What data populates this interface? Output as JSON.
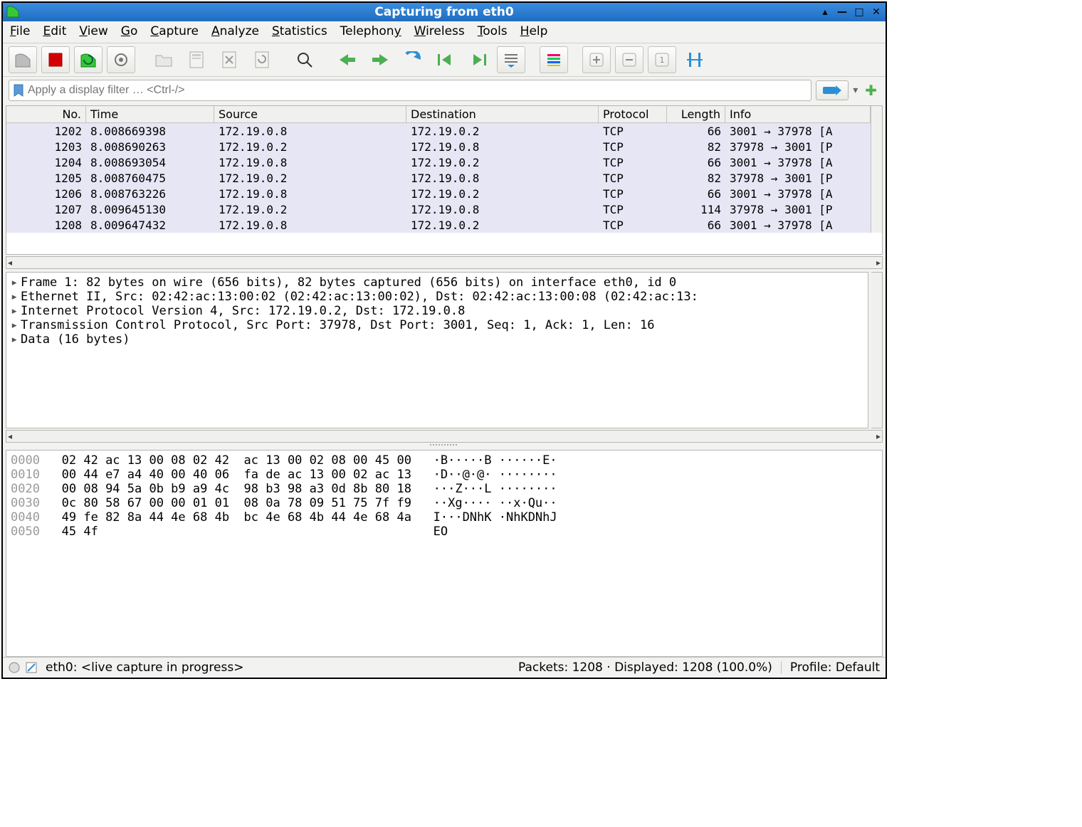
{
  "window": {
    "title": "Capturing from eth0"
  },
  "menu": {
    "items": [
      {
        "label": "File",
        "ukey": "F"
      },
      {
        "label": "Edit",
        "ukey": "E"
      },
      {
        "label": "View",
        "ukey": "V"
      },
      {
        "label": "Go",
        "ukey": "G"
      },
      {
        "label": "Capture",
        "ukey": "C"
      },
      {
        "label": "Analyze",
        "ukey": "A"
      },
      {
        "label": "Statistics",
        "ukey": "S"
      },
      {
        "label": "Telephony",
        "ukey": "y"
      },
      {
        "label": "Wireless",
        "ukey": "W"
      },
      {
        "label": "Tools",
        "ukey": "T"
      },
      {
        "label": "Help",
        "ukey": "H"
      }
    ]
  },
  "filter": {
    "placeholder": "Apply a display filter … <Ctrl-/>"
  },
  "columns": {
    "no": "No.",
    "time": "Time",
    "src": "Source",
    "dst": "Destination",
    "proto": "Protocol",
    "len": "Length",
    "info": "Info"
  },
  "packets": [
    {
      "no": "1202",
      "time": "8.008669398",
      "src": "172.19.0.8",
      "dst": "172.19.0.2",
      "proto": "TCP",
      "len": "66",
      "info": "3001 → 37978  [A"
    },
    {
      "no": "1203",
      "time": "8.008690263",
      "src": "172.19.0.2",
      "dst": "172.19.0.8",
      "proto": "TCP",
      "len": "82",
      "info": "37978 → 3001  [P"
    },
    {
      "no": "1204",
      "time": "8.008693054",
      "src": "172.19.0.8",
      "dst": "172.19.0.2",
      "proto": "TCP",
      "len": "66",
      "info": "3001 → 37978  [A"
    },
    {
      "no": "1205",
      "time": "8.008760475",
      "src": "172.19.0.2",
      "dst": "172.19.0.8",
      "proto": "TCP",
      "len": "82",
      "info": "37978 → 3001  [P"
    },
    {
      "no": "1206",
      "time": "8.008763226",
      "src": "172.19.0.8",
      "dst": "172.19.0.2",
      "proto": "TCP",
      "len": "66",
      "info": "3001 → 37978  [A"
    },
    {
      "no": "1207",
      "time": "8.009645130",
      "src": "172.19.0.2",
      "dst": "172.19.0.8",
      "proto": "TCP",
      "len": "114",
      "info": "37978 → 3001  [P"
    },
    {
      "no": "1208",
      "time": "8.009647432",
      "src": "172.19.0.8",
      "dst": "172.19.0.2",
      "proto": "TCP",
      "len": "66",
      "info": "3001 → 37978  [A"
    }
  ],
  "details": [
    "Frame 1: 82 bytes on wire (656 bits), 82 bytes captured (656 bits) on interface eth0, id 0",
    "Ethernet II, Src: 02:42:ac:13:00:02 (02:42:ac:13:00:02), Dst: 02:42:ac:13:00:08 (02:42:ac:13:",
    "Internet Protocol Version 4, Src: 172.19.0.2, Dst: 172.19.0.8",
    "Transmission Control Protocol, Src Port: 37978, Dst Port: 3001, Seq: 1, Ack: 1, Len: 16",
    "Data (16 bytes)"
  ],
  "hex": [
    {
      "off": "0000",
      "bytes": "02 42 ac 13 00 08 02 42  ac 13 00 02 08 00 45 00",
      "ascii": "·B·····B ······E·"
    },
    {
      "off": "0010",
      "bytes": "00 44 e7 a4 40 00 40 06  fa de ac 13 00 02 ac 13",
      "ascii": "·D··@·@· ········"
    },
    {
      "off": "0020",
      "bytes": "00 08 94 5a 0b b9 a9 4c  98 b3 98 a3 0d 8b 80 18",
      "ascii": "···Z···L ········"
    },
    {
      "off": "0030",
      "bytes": "0c 80 58 67 00 00 01 01  08 0a 78 09 51 75 7f f9",
      "ascii": "··Xg···· ··x·Qu··"
    },
    {
      "off": "0040",
      "bytes": "49 fe 82 8a 44 4e 68 4b  bc 4e 68 4b 44 4e 68 4a",
      "ascii": "I···DNhK ·NhKDNhJ"
    },
    {
      "off": "0050",
      "bytes": "45 4f                                           ",
      "ascii": "EO"
    }
  ],
  "status": {
    "capture": "eth0: <live capture in progress>",
    "packets": "Packets: 1208 · Displayed: 1208 (100.0%)",
    "profile": "Profile: Default"
  }
}
